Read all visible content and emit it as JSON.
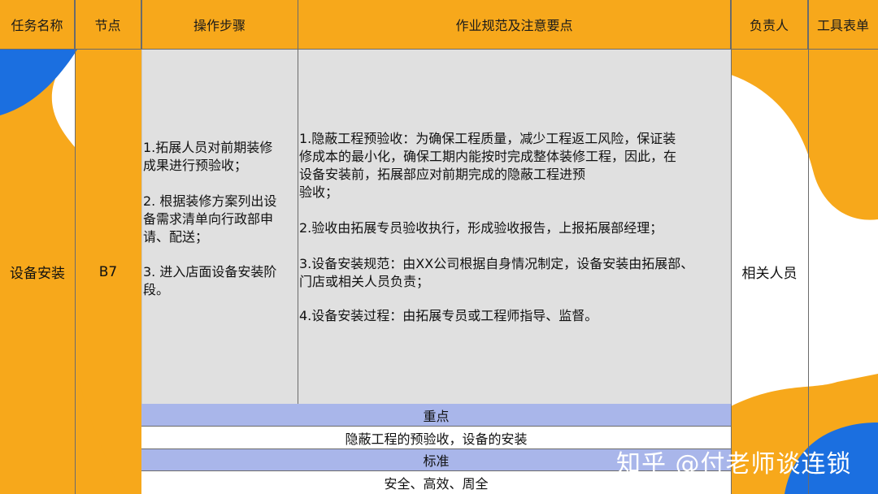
{
  "table": {
    "headers": [
      "任务名称",
      "节点",
      "操作步骤",
      "作业规范及注意要点",
      "负责人",
      "工具表单"
    ],
    "task_name": "设备安装",
    "node": "B7",
    "steps": [
      "1.拓展人员对前期装修\n成果进行预验收；",
      "2. 根据装修方案列出设\n备需求清单向行政部申\n请、配送；",
      "3. 进入店面设备安装阶\n段。"
    ],
    "specs": [
      "1.隐蔽工程预验收：为确保工程质量，减少工程返工风险，保证装\n修成本的最小化，确保工期内能按时完成整体装修工程，因此，在\n设备安装前，拓展部应对前期完成的隐蔽工程进预\n验收；",
      "2.验收由拓展专员验收执行，形成验收报告，上报拓展部经理；",
      "3.设备安装规范：由XX公司根据自身情况制定，设备安装由拓展部、\n门店或相关人员负责；",
      "4.设备安装过程：由拓展专员或工程师指导、监督。"
    ],
    "owner": "相关人员",
    "tools": "",
    "key_points_label": "重点",
    "key_points": "隐蔽工程的预验收，设备的安装",
    "standard_label": "标准",
    "standard": "安全、高效、周全"
  },
  "watermark": "知乎 @付老师谈连锁",
  "colors": {
    "header": "#f7a81b",
    "blob_orange": "#f7a81b",
    "blob_blue": "#1b6fe0",
    "band_blue": "#a9b6ea",
    "body_gray": "#dadada"
  }
}
